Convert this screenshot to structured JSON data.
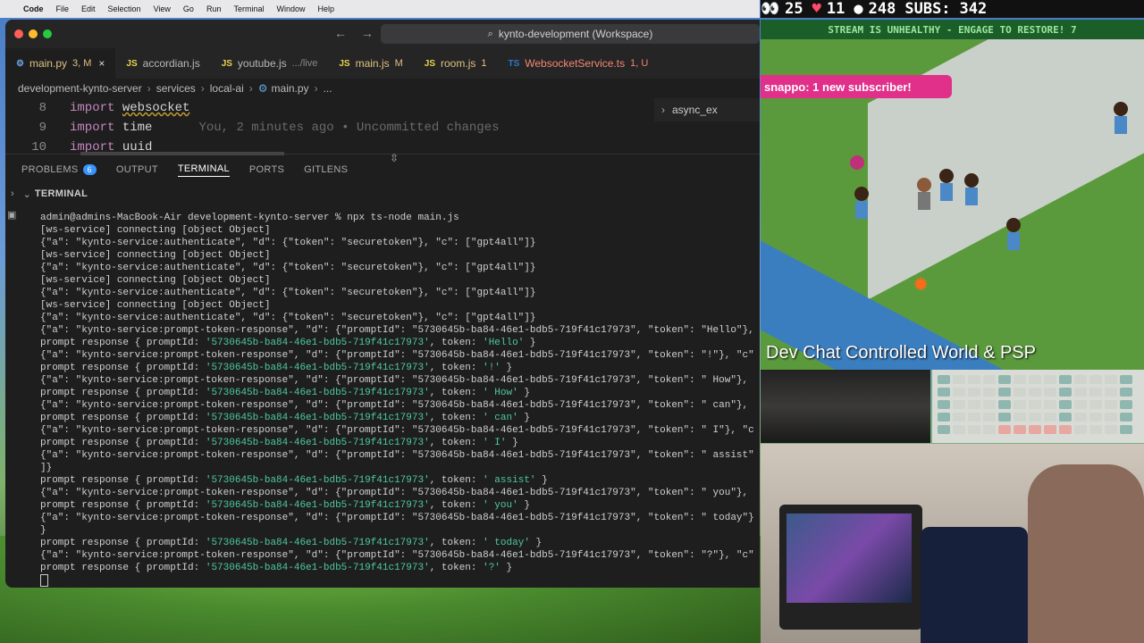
{
  "menubar": {
    "app": "Code",
    "items": [
      "File",
      "Edit",
      "Selection",
      "View",
      "Go",
      "Run",
      "Terminal",
      "Window",
      "Help"
    ]
  },
  "window": {
    "search": "kynto-development (Workspace)"
  },
  "tabs": [
    {
      "icon": "py",
      "name": "main.py",
      "badge": "3, M",
      "close": "×",
      "color": "#e0c080"
    },
    {
      "icon": "JS",
      "name": "accordian.js",
      "badge": "",
      "close": "",
      "color": "#cccccc"
    },
    {
      "icon": "JS",
      "name": "youtube.js",
      "badge": ".../live",
      "close": "",
      "color": "#cccccc"
    },
    {
      "icon": "JS",
      "name": "main.js",
      "badge": "M",
      "close": "",
      "color": "#e0c080"
    },
    {
      "icon": "JS",
      "name": "room.js",
      "badge": "1",
      "close": "",
      "color": "#e0c080"
    },
    {
      "icon": "TS",
      "name": "WebsocketService.ts",
      "badge": "1, U",
      "close": "",
      "color": "#f48771"
    }
  ],
  "breadcrumbs": [
    "development-kynto-server",
    "services",
    "local-ai",
    "main.py",
    "..."
  ],
  "editor": {
    "lines": [
      {
        "n": "8",
        "kw": "import",
        "mod": "websocket",
        "blame": ""
      },
      {
        "n": "9",
        "kw": "import",
        "mod": "time",
        "blame": "You, 2 minutes ago • Uncommitted changes"
      },
      {
        "n": "10",
        "kw": "import",
        "mod": "uuid",
        "blame": ""
      }
    ],
    "outline": "async_ex"
  },
  "panel": {
    "tabs": [
      "PROBLEMS",
      "OUTPUT",
      "TERMINAL",
      "PORTS",
      "GITLENS"
    ],
    "problems_count": "6",
    "active": "TERMINAL",
    "terminal_title": "TERMINAL"
  },
  "terminal": {
    "prompt": "admin@admins-MacBook-Air development-kynto-server % npx ts-node main.js",
    "lines": [
      "[ws-service] connecting [object Object]",
      "{\"a\": \"kynto-service:authenticate\", \"d\": {\"token\": \"securetoken\"}, \"c\": [\"gpt4all\"]}",
      "[ws-service] connecting [object Object]",
      "{\"a\": \"kynto-service:authenticate\", \"d\": {\"token\": \"securetoken\"}, \"c\": [\"gpt4all\"]}",
      "[ws-service] connecting [object Object]",
      "{\"a\": \"kynto-service:authenticate\", \"d\": {\"token\": \"securetoken\"}, \"c\": [\"gpt4all\"]}",
      "[ws-service] connecting [object Object]",
      "{\"a\": \"kynto-service:authenticate\", \"d\": {\"token\": \"securetoken\"}, \"c\": [\"gpt4all\"]}",
      "{\"a\": \"kynto-service:prompt-token-response\", \"d\": {\"promptId\": \"5730645b-ba84-46e1-bdb5-719f41c17973\", \"token\": \"Hello\"},",
      "prompt response { promptId: '5730645b-ba84-46e1-bdb5-719f41c17973', token: 'Hello' }",
      "{\"a\": \"kynto-service:prompt-token-response\", \"d\": {\"promptId\": \"5730645b-ba84-46e1-bdb5-719f41c17973\", \"token\": \"!\"}, \"c\"",
      "prompt response { promptId: '5730645b-ba84-46e1-bdb5-719f41c17973', token: '!' }",
      "{\"a\": \"kynto-service:prompt-token-response\", \"d\": {\"promptId\": \"5730645b-ba84-46e1-bdb5-719f41c17973\", \"token\": \" How\"},",
      "prompt response { promptId: '5730645b-ba84-46e1-bdb5-719f41c17973', token: ' How' }",
      "{\"a\": \"kynto-service:prompt-token-response\", \"d\": {\"promptId\": \"5730645b-ba84-46e1-bdb5-719f41c17973\", \"token\": \" can\"},",
      "prompt response { promptId: '5730645b-ba84-46e1-bdb5-719f41c17973', token: ' can' }",
      "{\"a\": \"kynto-service:prompt-token-response\", \"d\": {\"promptId\": \"5730645b-ba84-46e1-bdb5-719f41c17973\", \"token\": \" I\"}, \"c",
      "prompt response { promptId: '5730645b-ba84-46e1-bdb5-719f41c17973', token: ' I' }",
      "{\"a\": \"kynto-service:prompt-token-response\", \"d\": {\"promptId\": \"5730645b-ba84-46e1-bdb5-719f41c17973\", \"token\": \" assist\"",
      "]}",
      "prompt response { promptId: '5730645b-ba84-46e1-bdb5-719f41c17973', token: ' assist' }",
      "{\"a\": \"kynto-service:prompt-token-response\", \"d\": {\"promptId\": \"5730645b-ba84-46e1-bdb5-719f41c17973\", \"token\": \" you\"},",
      "prompt response { promptId: '5730645b-ba84-46e1-bdb5-719f41c17973', token: ' you' }",
      "{\"a\": \"kynto-service:prompt-token-response\", \"d\": {\"promptId\": \"5730645b-ba84-46e1-bdb5-719f41c17973\", \"token\": \" today\"}",
      "}",
      "prompt response { promptId: '5730645b-ba84-46e1-bdb5-719f41c17973', token: ' today' }",
      "{\"a\": \"kynto-service:prompt-token-response\", \"d\": {\"promptId\": \"5730645b-ba84-46e1-bdb5-719f41c17973\", \"token\": \"?\"}, \"c\"",
      "prompt response { promptId: '5730645b-ba84-46e1-bdb5-719f41c17973', token: '?' }"
    ]
  },
  "stream": {
    "stats": {
      "eyes": "25",
      "hearts": "11",
      "chat": "248",
      "subs_label": "SUBS:",
      "subs": "342"
    },
    "banner": "STREAM IS UNHEALTHY - ENGAGE TO RESTORE! 7",
    "notification": "snappo: 1 new subscriber!",
    "caption": "Dev Chat Controlled World & PSP"
  },
  "colors": {
    "vscode_bg": "#1e1e1e",
    "accent": "#3794ff",
    "string": "#4ec9a0",
    "stream_pink": "#e0308a"
  }
}
